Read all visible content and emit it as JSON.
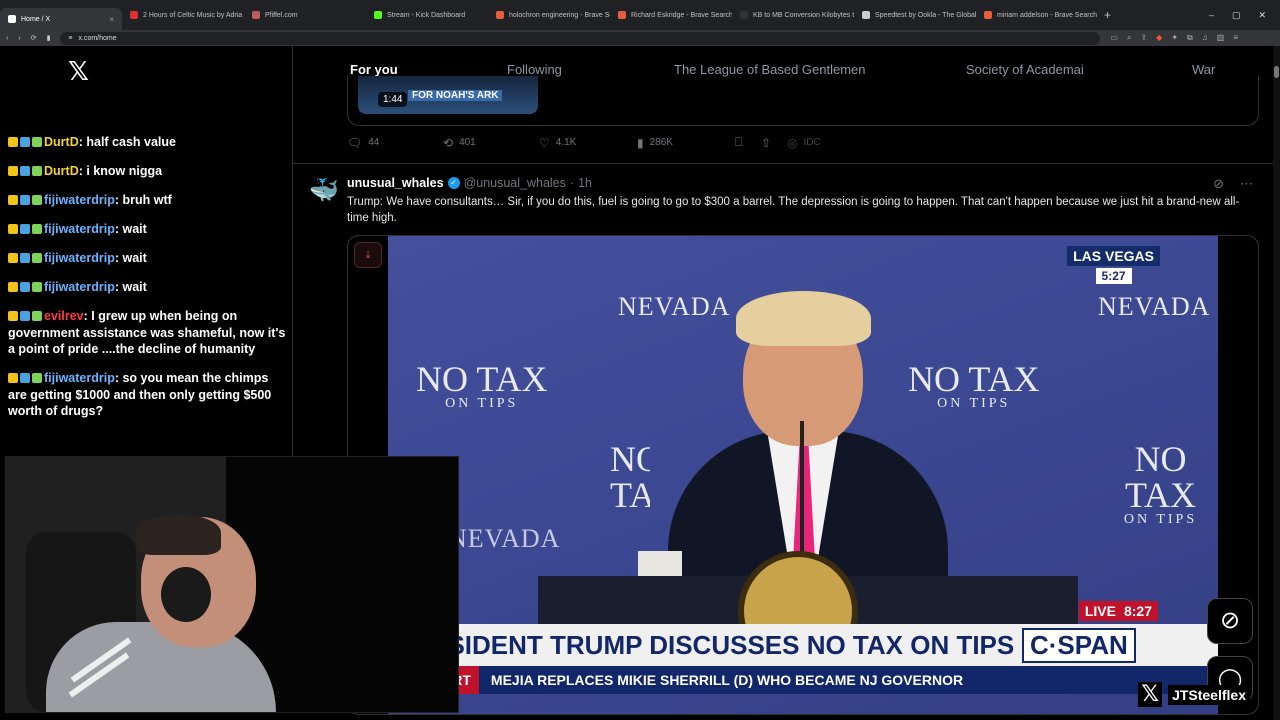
{
  "browser": {
    "tabs": [
      {
        "label": "Home / X",
        "color": "#ffffff"
      },
      {
        "label": "2 Hours of Celtic Music by Adria",
        "color": "#e03131"
      },
      {
        "label": "Pfiffel.com",
        "color": "#c05a5a"
      },
      {
        "label": "Stream - Kick Dashboard",
        "color": "#53fc18"
      },
      {
        "label": "holochron engineering - Brave Sear",
        "color": "#e85d3d"
      },
      {
        "label": "Richard Eskridge - Brave Search",
        "color": "#e85d3d"
      },
      {
        "label": "KB to MB Conversion Kilobytes to M",
        "color": "#333333"
      },
      {
        "label": "Speedtest by Ookla - The Global Bro",
        "color": "#cccccc"
      },
      {
        "label": "miriam addelson - Brave Search",
        "color": "#e85d3d"
      }
    ],
    "url": "x.com/home"
  },
  "chat": {
    "messages": [
      {
        "user": "DurtD",
        "text": "half cash value",
        "color": "#f5d33a"
      },
      {
        "user": "DurtD",
        "text": "i know nigga",
        "color": "#f5d33a"
      },
      {
        "user": "fijiwaterdrip",
        "text": "bruh wtf",
        "color": "#6ab4ff"
      },
      {
        "user": "fijiwaterdrip",
        "text": "wait",
        "color": "#6ab4ff"
      },
      {
        "user": "fijiwaterdrip",
        "text": "wait",
        "color": "#6ab4ff"
      },
      {
        "user": "fijiwaterdrip",
        "text": "wait",
        "color": "#6ab4ff"
      },
      {
        "user": "evilrev",
        "text": "I grew up when being on government assistance was shameful, now it's a point of pride ....the decline of humanity",
        "color": "#ff3c3c"
      },
      {
        "user": "fijiwaterdrip",
        "text": "so you mean the chimps are getting $1000 and then only getting $500 worth of drugs?",
        "color": "#6ab4ff"
      }
    ]
  },
  "feed": {
    "tabs": [
      "For you",
      "Following",
      "The League of Based Gentlemen",
      "Society of Academai",
      "War"
    ],
    "prev_post": {
      "duration": "1:44",
      "banner": "FOR NOAH'S ARK",
      "replies": "44",
      "reposts": "401",
      "likes": "4.1K",
      "views": "286K",
      "extra": "IDC"
    },
    "post": {
      "name": "unusual_whales",
      "handle": "@unusual_whales",
      "time": "1h",
      "text": "Trump: We have consultants… Sir, if you do this, fuel is going to go to $300 a barrel. The depression is going to happen. That can't happen because we just hit a brand-new all-time high.",
      "video": {
        "sign_main": "NO TAX",
        "sign_sub": "ON TIPS",
        "sign_state": "NEVADA",
        "location": "LAS VEGAS",
        "loc_time": "5:27",
        "live_label": "LIVE",
        "live_time": "8:27",
        "headline": "PRESIDENT TRUMP DISCUSSES NO TAX ON TIPS POLICY",
        "network": "C·SPAN",
        "alert": "ION ALERT",
        "ticker": "MEJIA REPLACES MIKIE SHERRILL (D) WHO BECAME NJ GOVERNOR"
      }
    }
  },
  "stream": {
    "watermark": "JTSteelflex"
  }
}
